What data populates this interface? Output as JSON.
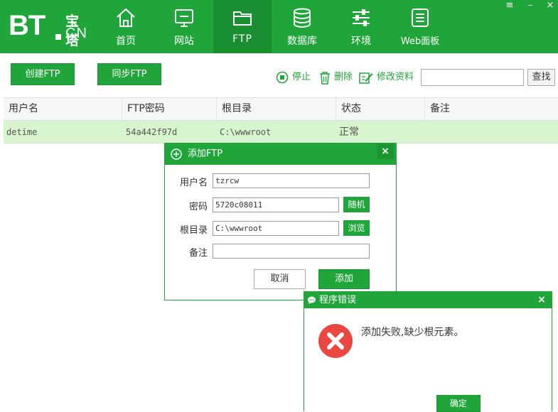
{
  "logo": {
    "bt": "BT",
    "zh": "宝塔",
    "cn": "CN"
  },
  "nav": {
    "items": [
      {
        "label": "首页",
        "icon": "home-icon"
      },
      {
        "label": "网站",
        "icon": "monitor-icon"
      },
      {
        "label": "FTP",
        "icon": "folder-icon"
      },
      {
        "label": "数据库",
        "icon": "database-icon"
      },
      {
        "label": "环境",
        "icon": "sliders-icon"
      },
      {
        "label": "Web面板",
        "icon": "document-icon"
      }
    ],
    "active": "FTP"
  },
  "window_controls": {
    "menu": "≡",
    "minimize": "–",
    "close": "×"
  },
  "toolbar": {
    "create_label": "创建FTP",
    "sync_label": "同步FTP",
    "stop_label": "停止",
    "delete_label": "删除",
    "edit_label": "修改资料",
    "search_value": "",
    "search_button": "查找"
  },
  "table": {
    "columns": [
      "用户名",
      "FTP密码",
      "根目录",
      "状态",
      "备注"
    ],
    "rows": [
      {
        "username": "detime",
        "password": "54a442f97d",
        "root": "C:\\wwwroot",
        "status": "正常",
        "note": ""
      }
    ]
  },
  "add_ftp_dialog": {
    "title": "添加FTP",
    "close": "×",
    "username_label": "用户名",
    "username_value": "tzrcw",
    "password_label": "密码",
    "password_value": "5720c08011",
    "random_button": "随机",
    "root_label": "根目录",
    "root_value": "C:\\wwwroot",
    "browse_button": "浏览",
    "note_label": "备注",
    "note_value": "",
    "cancel_button": "取消",
    "add_button": "添加"
  },
  "error_dialog": {
    "title": "程序错误",
    "close": "×",
    "message": "添加失败,缺少根元素。",
    "ok_button": "确定"
  },
  "colors": {
    "brand_green": "#20a53a",
    "active_nav": "#1a8f31",
    "selected_row": "#d6f4cd",
    "error_red": "#e9473f"
  }
}
